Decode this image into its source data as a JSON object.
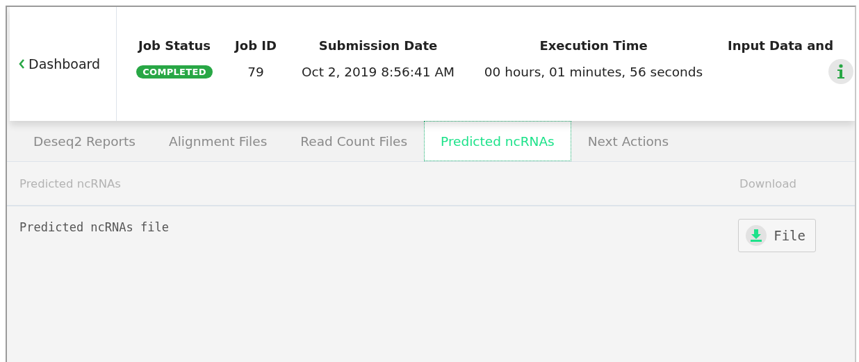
{
  "back_link": {
    "label": "Dashboard"
  },
  "job_summary": {
    "columns": [
      "Job Status",
      "Job ID",
      "Submission Date",
      "Execution Time",
      "Input Data and"
    ],
    "status": {
      "label": "COMPLETED",
      "color": "#28a745"
    },
    "job_id": "79",
    "submission_date": "Oct 2, 2019 8:56:41 AM",
    "execution_time": "00 hours, 01 minutes, 56 seconds"
  },
  "tabs": [
    {
      "label": "Deseq2 Reports",
      "selected": false
    },
    {
      "label": "Alignment Files",
      "selected": false
    },
    {
      "label": "Read Count Files",
      "selected": false
    },
    {
      "label": "Predicted ncRNAs",
      "selected": true
    },
    {
      "label": "Next Actions",
      "selected": false
    }
  ],
  "table": {
    "columns": [
      "Predicted ncRNAs",
      "Download"
    ],
    "rows": [
      {
        "name": "Predicted ncRNAs file",
        "button": "File"
      }
    ]
  }
}
